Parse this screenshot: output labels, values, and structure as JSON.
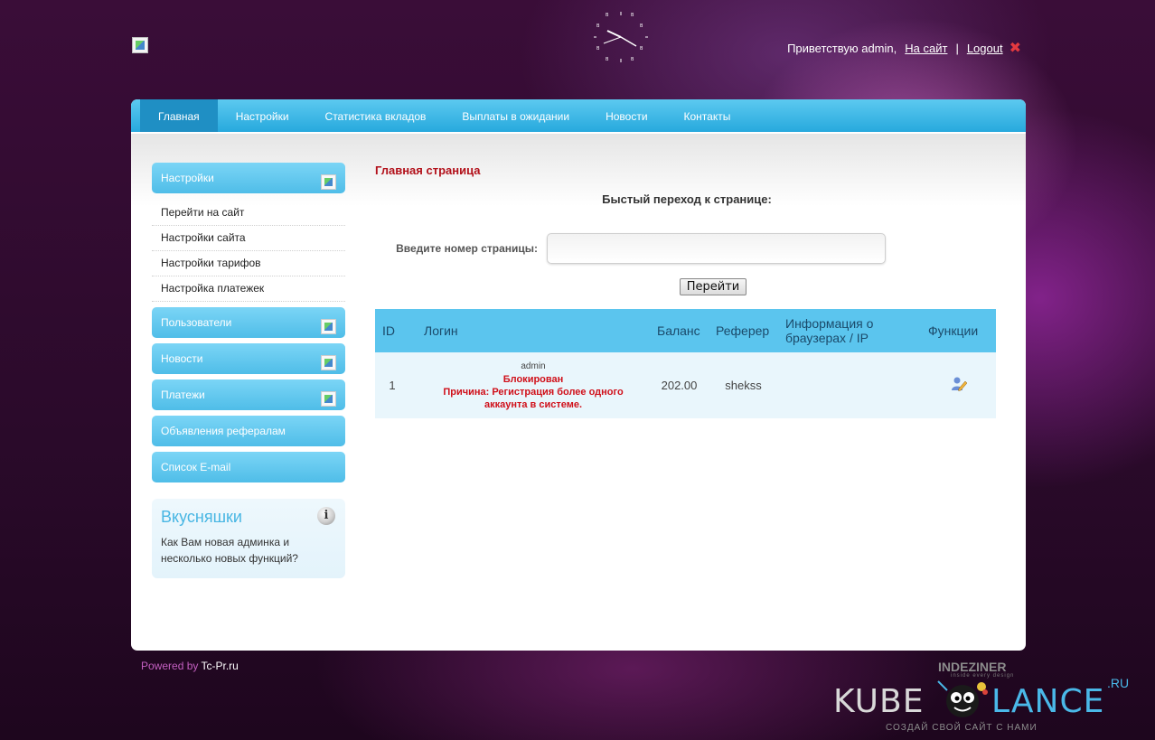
{
  "header": {
    "logo_alt": "",
    "greeting": "Приветствую admin,",
    "site_link": "На сайт",
    "separator": "|",
    "logout": "Logout",
    "logout_icon": "close-icon",
    "accent_red": "#e3393f"
  },
  "nav": {
    "items": [
      {
        "label": "Главная",
        "active": true
      },
      {
        "label": "Настройки"
      },
      {
        "label": "Статистика вкладов"
      },
      {
        "label": "Выплаты в ожидании"
      },
      {
        "label": "Новости"
      },
      {
        "label": "Контакты"
      }
    ],
    "color": "#27a9dd"
  },
  "sidebar": {
    "settings_title": "Настройки",
    "settings_links": [
      "Перейти на сайт",
      "Настройки сайта",
      "Настройки тарифов",
      "Настройка платежек"
    ],
    "blocks": [
      "Пользователи",
      "Новости",
      "Платежи",
      "Объявления рефералам",
      "Список E-mail"
    ],
    "tips": {
      "title": "Вкусняшки",
      "text": "Как Вам новая админка и несколько новых функций?",
      "icon": "info-icon"
    }
  },
  "main": {
    "page_title": "Главная страница",
    "quick_title": "Быстый переход к странице:",
    "page_input_label": "Введите номер страницы:",
    "page_input_value": "",
    "go_button": "Перейти",
    "table": {
      "headers": [
        "ID",
        "Логин",
        "Баланс",
        "Реферер",
        "Информация о браузерах / IP",
        "Функции"
      ],
      "rows": [
        {
          "id": "1",
          "login": "admin",
          "status": "Блокирован",
          "reason": "Причина: Регистрация более одного аккаунта в системе.",
          "balance": "202.00",
          "referrer": "shekss",
          "info": "",
          "action_icon": "edit-user-icon"
        }
      ]
    }
  },
  "footer": {
    "powered_by": "Powered by",
    "powered_link": "Tc-Pr.ru",
    "brand_top": "INDEZINER",
    "brand_top_sub": "inside every design",
    "brand_left": "KUBE",
    "brand_right": "LANCE",
    "brand_tld": ".RU",
    "brand_slogan": "СОЗДАЙ СВОЙ САЙТ С НАМИ"
  }
}
